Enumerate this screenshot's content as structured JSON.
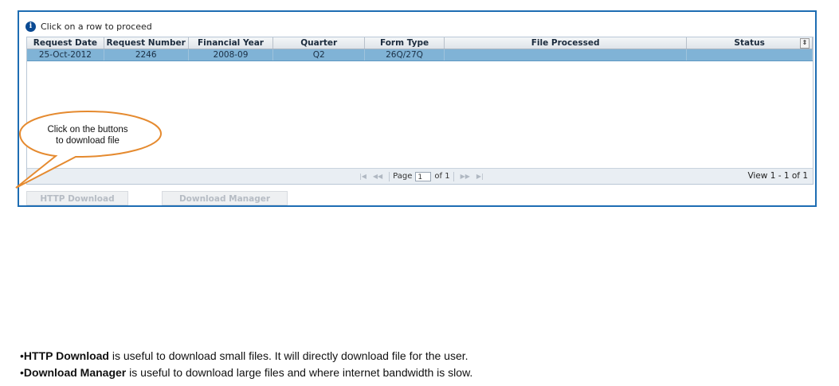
{
  "info": {
    "icon": "info-icon",
    "text": "Click on a row to proceed"
  },
  "grid": {
    "columns": [
      "Request Date",
      "Request Number",
      "Financial Year",
      "Quarter",
      "Form Type",
      "File Processed",
      "Status"
    ],
    "rows": [
      [
        "25-Oct-2012",
        "2246",
        "2008-09",
        "Q2",
        "26Q/27Q",
        "",
        ""
      ]
    ],
    "sort_icon": "sort-icon"
  },
  "pager": {
    "page_label": "Page",
    "page_value": "1",
    "of_label": "of 1",
    "view_text": "View 1 - 1 of 1"
  },
  "buttons": {
    "http_download": "HTTP Download",
    "download_manager": "Download Manager"
  },
  "callout": {
    "line1": "Click on the buttons",
    "line2": "to download file",
    "colors": {
      "stroke": "#e58a2f"
    }
  },
  "notes": [
    {
      "bullet": "•",
      "bold": "HTTP Download",
      "rest": " is useful to download small files. It will directly download file for the user."
    },
    {
      "bullet": "•",
      "bold": "Download Manager",
      "rest": " is useful to download large files and where internet bandwidth is slow."
    }
  ],
  "colors": {
    "frame_border": "#1e6db3",
    "selected_row": "#80b3d6"
  }
}
